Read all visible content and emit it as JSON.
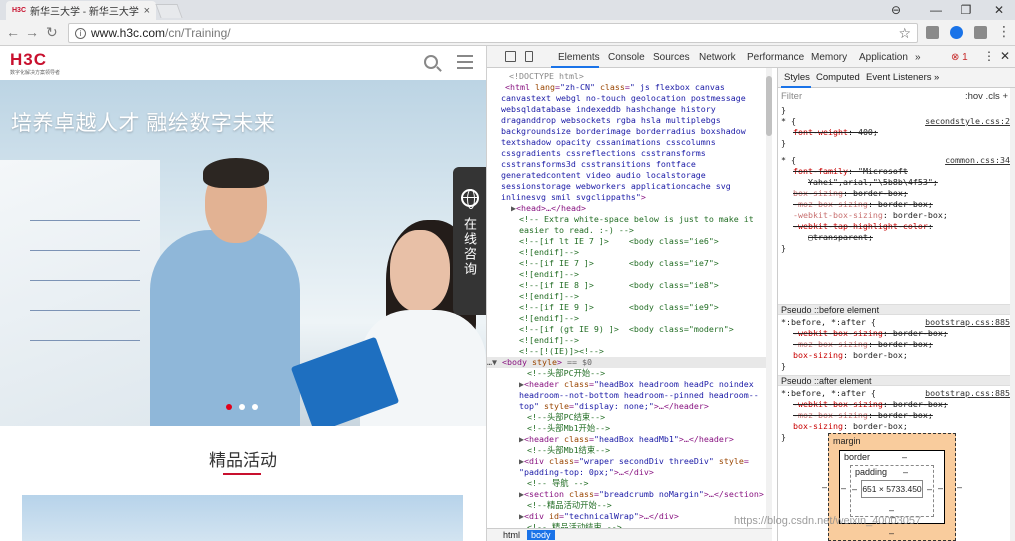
{
  "browser": {
    "tab_favicon": "H3C",
    "tab_title": "新华三大学 - 新华三大学",
    "tab_close": "×",
    "url_host": "www.h3c.com",
    "url_path": "/cn/Training/",
    "window_controls": [
      "⊖",
      "—",
      "❐",
      "✕"
    ]
  },
  "page": {
    "logo_text": "H3C",
    "logo_tagline": "数字化解决方案领导者",
    "banner_title": "培养卓越人才 融绘数字未来",
    "consult_label": "在线咨询",
    "section_title": "精品活动",
    "carousel_dots": 3,
    "carousel_active_index": 0
  },
  "devtools": {
    "tabs": [
      "Elements",
      "Console",
      "Sources",
      "Network",
      "Performance",
      "Memory",
      "Application"
    ],
    "active_tab": "Elements",
    "more": "»",
    "error_count": "1",
    "crumbs": [
      "html",
      "body"
    ],
    "active_crumb": "body",
    "styles_tabs": [
      "Styles",
      "Computed",
      "Event Listeners"
    ],
    "filter_placeholder": "Filter",
    "filter_controls": ":hov  .cls  +",
    "pseudo_before": "Pseudo ::before element",
    "pseudo_after": "Pseudo ::after element",
    "box_model": {
      "margin_label": "margin",
      "border_label": "border",
      "padding_label": "padding",
      "dash": "–",
      "content_size": "651 × 5733.450"
    }
  },
  "watermark": "https://blog.csdn.net/weixin_40003057"
}
